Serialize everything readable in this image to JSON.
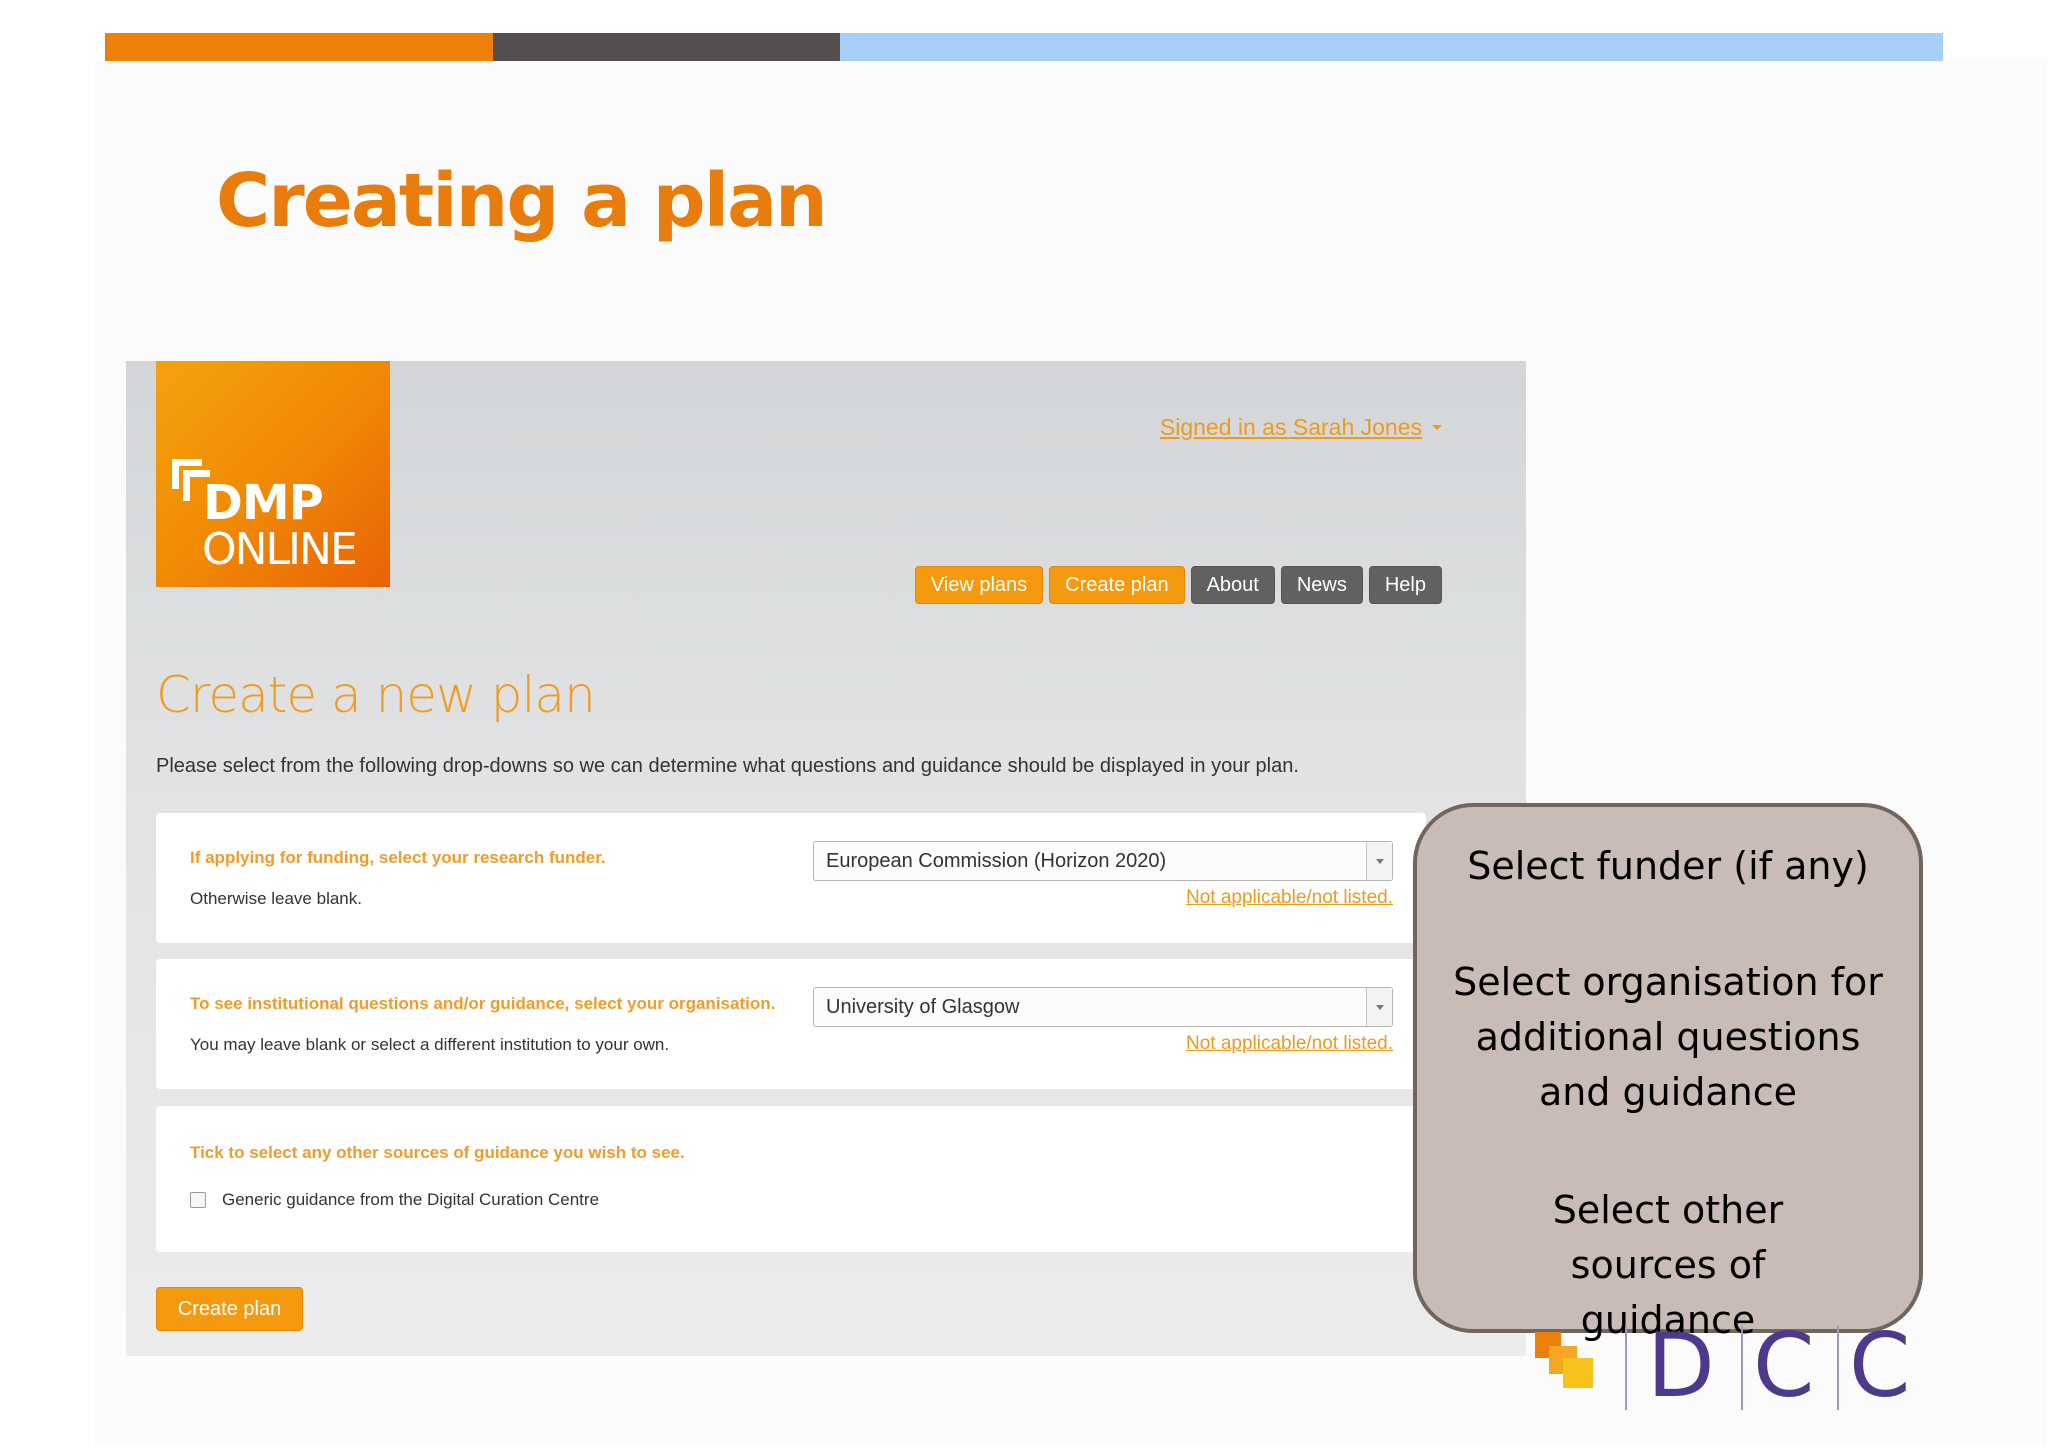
{
  "slide": {
    "title": "Creating a plan",
    "top_bar_colors": [
      "#ee7f0b",
      "#534f4d",
      "#a7cff9"
    ]
  },
  "app": {
    "logo": {
      "line1": "DMP",
      "line2": "ONLINE"
    },
    "signed_in": "Signed in as Sarah Jones",
    "nav": [
      {
        "label": "View plans",
        "style": "orange"
      },
      {
        "label": "Create plan",
        "style": "orange"
      },
      {
        "label": "About",
        "style": "grey"
      },
      {
        "label": "News",
        "style": "grey"
      },
      {
        "label": "Help",
        "style": "grey"
      }
    ],
    "heading": "Create a new plan",
    "intro": "Please select from the following drop-downs so we can determine what questions and guidance should be displayed in your plan.",
    "funder": {
      "question": "If applying for funding, select your research funder.",
      "sub": "Otherwise leave blank.",
      "value": "European Commission (Horizon 2020)",
      "link": "Not applicable/not listed."
    },
    "organisation": {
      "question": "To see institutional questions and/or guidance, select your organisation.",
      "sub": "You may leave blank or select a different institution to your own.",
      "value": "University of Glasgow",
      "link": "Not applicable/not listed."
    },
    "guidance": {
      "question": "Tick to select any other sources of guidance you wish to see.",
      "checkbox_label": "Generic guidance from the Digital Curation Centre",
      "checked": false
    },
    "create_button": "Create plan"
  },
  "callout": {
    "line1": "Select funder (if any)",
    "line2": "Select organisation for additional questions and guidance",
    "line3": "Select other sources of guidance"
  },
  "footer_logo": {
    "letters": [
      "D",
      "C",
      "C"
    ]
  },
  "colors": {
    "accent": "#f59a0f",
    "title": "#e87d0d",
    "callout_fill": "#c9bcb6",
    "dcc_purple": "#4d3a8c"
  }
}
